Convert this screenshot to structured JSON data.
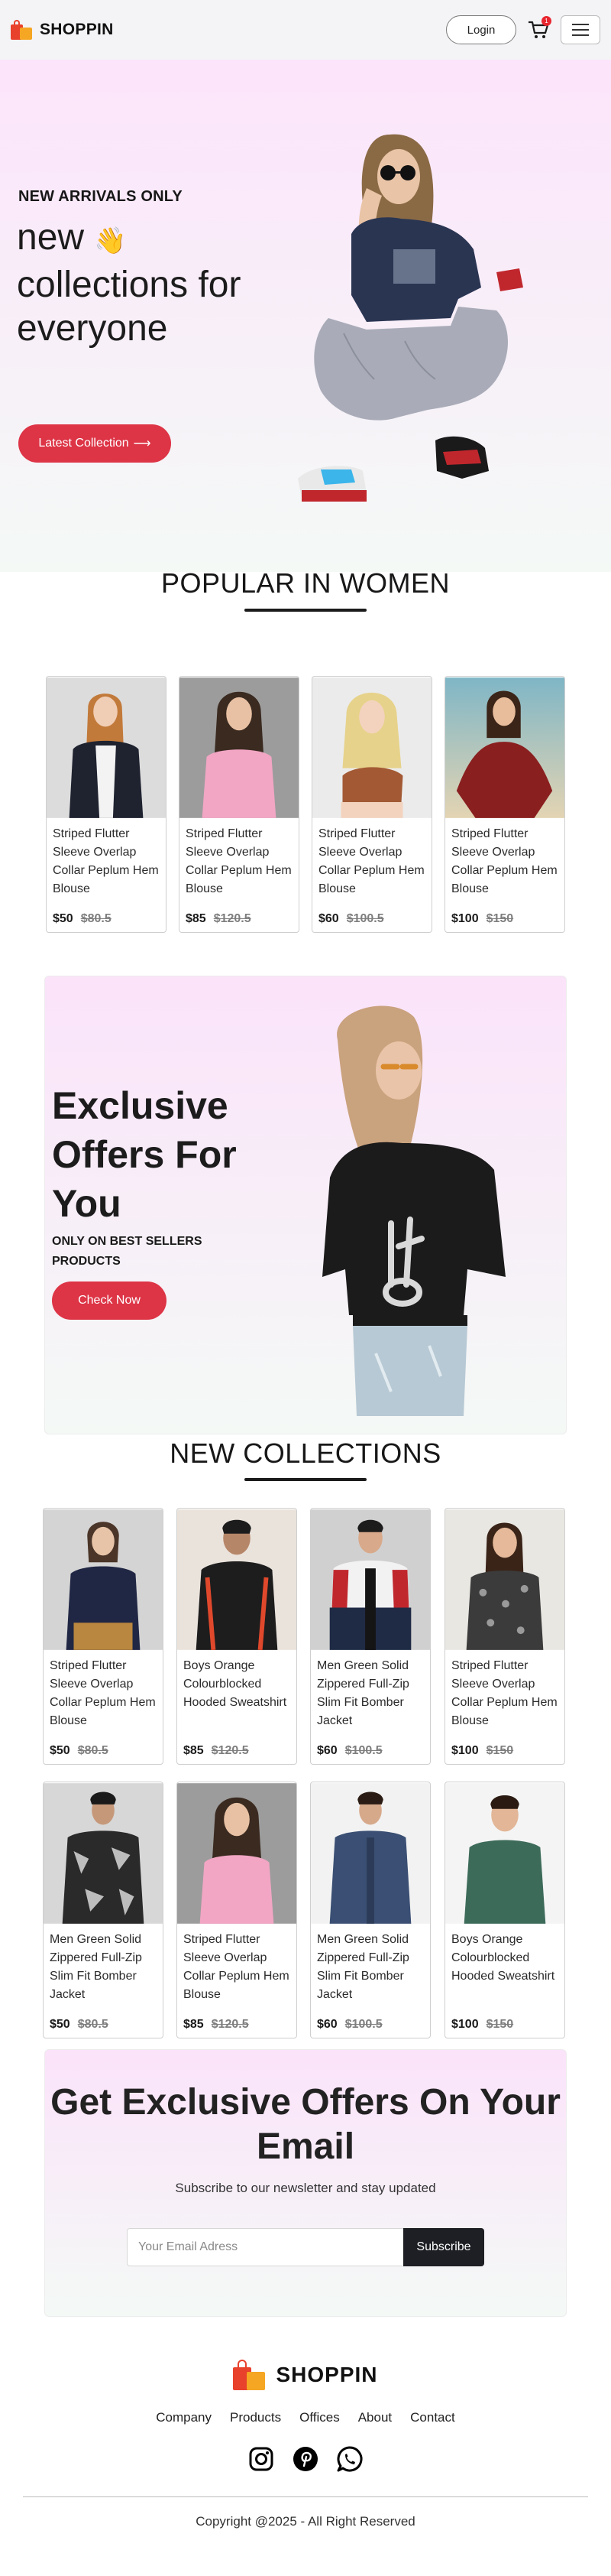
{
  "nav": {
    "brand": "SHOPPIN",
    "login_label": "Login",
    "cart_count": "1"
  },
  "hero": {
    "tag": "NEW ARRIVALS ONLY",
    "title_line1": "new",
    "title_rest": "collections for everyone",
    "wave_emoji": "👋",
    "button_label": "Latest Collection",
    "button_arrow": "⟶"
  },
  "popular": {
    "title": "POPULAR IN WOMEN",
    "items": [
      {
        "name": "Striped Flutter Sleeve Overlap Collar Peplum Hem Blouse",
        "price": "$50",
        "old_price": "$80.5"
      },
      {
        "name": "Striped Flutter Sleeve Overlap Collar Peplum Hem Blouse",
        "price": "$85",
        "old_price": "$120.5"
      },
      {
        "name": "Striped Flutter Sleeve Overlap Collar Peplum Hem Blouse",
        "price": "$60",
        "old_price": "$100.5"
      },
      {
        "name": "Striped Flutter Sleeve Overlap Collar Peplum Hem Blouse",
        "price": "$100",
        "old_price": "$150"
      }
    ]
  },
  "offers": {
    "title": "Exclusive Offers For You",
    "subtitle": "ONLY ON BEST SELLERS PRODUCTS",
    "button_label": "Check Now"
  },
  "collections": {
    "title": "NEW COLLECTIONS",
    "items": [
      {
        "name": "Striped Flutter Sleeve Overlap Collar Peplum Hem Blouse",
        "price": "$50",
        "old_price": "$80.5"
      },
      {
        "name": "Boys Orange Colourblocked Hooded Sweatshirt",
        "price": "$85",
        "old_price": "$120.5"
      },
      {
        "name": "Men Green Solid Zippered Full-Zip Slim Fit Bomber Jacket",
        "price": "$60",
        "old_price": "$100.5"
      },
      {
        "name": "Striped Flutter Sleeve Overlap Collar Peplum Hem Blouse",
        "price": "$100",
        "old_price": "$150"
      },
      {
        "name": "Men Green Solid Zippered Full-Zip Slim Fit Bomber Jacket",
        "price": "$50",
        "old_price": "$80.5"
      },
      {
        "name": "Striped Flutter Sleeve Overlap Collar Peplum Hem Blouse",
        "price": "$85",
        "old_price": "$120.5"
      },
      {
        "name": "Men Green Solid Zippered Full-Zip Slim Fit Bomber Jacket",
        "price": "$60",
        "old_price": "$100.5"
      },
      {
        "name": "Boys Orange Colourblocked Hooded Sweatshirt",
        "price": "$100",
        "old_price": "$150"
      }
    ]
  },
  "newsletter": {
    "title": "Get Exclusive Offers On Your Email",
    "subtitle": "Subscribe to our newsletter and stay updated",
    "placeholder": "Your Email Adress",
    "button_label": "Subscribe"
  },
  "footer": {
    "brand": "SHOPPIN",
    "links": [
      "Company",
      "Products",
      "Offices",
      "About",
      "Contact"
    ],
    "social_icons": [
      "instagram-icon",
      "pinterest-icon",
      "whatsapp-icon"
    ],
    "copyright": "Copyright @2025 - All Right Reserved"
  },
  "colors": {
    "accent": "#dd3446",
    "hero_gradient_top": "#fce4fb",
    "hero_gradient_bottom": "#f4f9f6",
    "dark_button": "#1d1f24"
  }
}
